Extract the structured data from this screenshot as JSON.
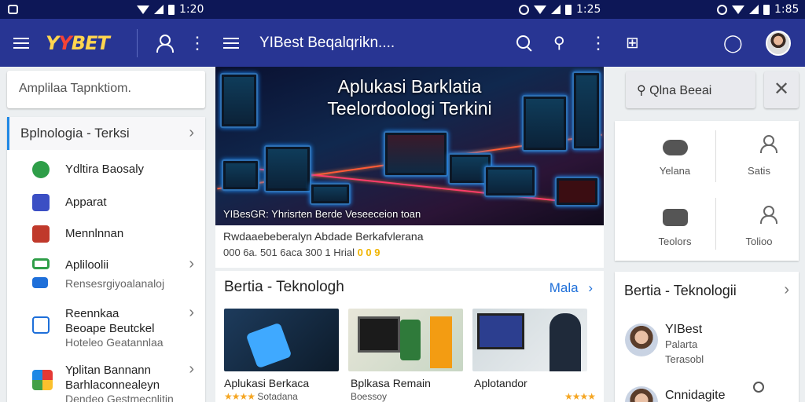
{
  "status_bars": [
    {
      "time": "1:20"
    },
    {
      "time": "1:25"
    },
    {
      "time": "1:85"
    }
  ],
  "appbar": {
    "logo": {
      "part1": "Y",
      "part2": "Y",
      "part3": "BET"
    },
    "page_title": "YIBest Beqalqrikn...."
  },
  "left": {
    "search_placeholder": "Amplilaa Tapnktiom.",
    "menu_header": "Bplnologia - Terksi",
    "items": [
      {
        "label": "Ydltira Baosaly"
      },
      {
        "label": "Apparat"
      },
      {
        "label": "Mennlnnan"
      },
      {
        "label": "Apliloolii",
        "sub": "Rensesrgiyoalanaloj"
      },
      {
        "label": "Reennkaa",
        "label2": "Beoape Beutckel",
        "sub": "Hoteleo Geatannlaa"
      },
      {
        "label": "Yplitan Bannann",
        "label2": "Barhlaconnealeyn",
        "sub": "Dendeo Gestmecnlitin"
      }
    ]
  },
  "banner": {
    "title_line1": "Aplukasi Barklatia",
    "title_line2": "Teelordoologi Terkini",
    "caption": "YIBesGR: Yhrisrten Berde Veseeceion toan"
  },
  "main_card": {
    "description": "Rwdaaebeberalyn Abdade Berkafvlerana",
    "meta": "000 6a. 501 6aca 300 1 Hrial",
    "meta_coin": "0 0 9",
    "section_title": "Bertia - Teknologh",
    "more_label": "Mala"
  },
  "thumbs": [
    {
      "title": "Aplukasi Berkaca",
      "stars": "★★★★",
      "sub": "Sotadana"
    },
    {
      "title": "Bplkasa Remain",
      "sub": "Boessoy"
    },
    {
      "title": "Aplotandor",
      "stars": "★★★★",
      "sub": ""
    }
  ],
  "right": {
    "search_label": "Qlna Beeai",
    "grid": [
      {
        "label": "Yelana"
      },
      {
        "label": "Satis"
      },
      {
        "label": "Teolors"
      },
      {
        "label": "Tolioo"
      }
    ],
    "list_title": "Bertia - Teknologii",
    "list": [
      {
        "name": "YIBest",
        "line2": "Palarta",
        "line3": "Terasobl"
      },
      {
        "name": "Cnnidagite"
      }
    ]
  },
  "colors": {
    "status_bar": "#0d1757",
    "app_bar": "#283593",
    "accent_blue": "#1e6fd9",
    "star": "#f5a623"
  }
}
